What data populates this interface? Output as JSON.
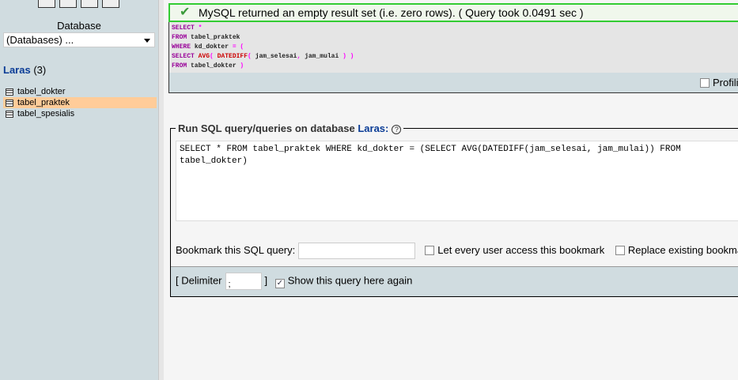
{
  "sidebar": {
    "toolbar_icons": [
      "home-icon",
      "sql-icon",
      "query-window-icon",
      "docs-icon"
    ],
    "database_label": "Database",
    "database_select": "(Databases) ...",
    "db_name": "Laras",
    "db_count": "(3)",
    "tables": [
      {
        "name": "tabel_dokter",
        "selected": false
      },
      {
        "name": "tabel_praktek",
        "selected": true
      },
      {
        "name": "tabel_spesialis",
        "selected": false
      }
    ]
  },
  "result": {
    "message": "MySQL returned an empty result set (i.e. zero rows). ( Query took 0.0491 sec )",
    "sql_lines": [
      [
        {
          "t": "SELECT",
          "c": "kw"
        },
        {
          "t": " *",
          "c": "pu"
        }
      ],
      [
        {
          "t": "FROM",
          "c": "kw"
        },
        {
          "t": " tabel_praktek",
          "c": ""
        }
      ],
      [
        {
          "t": "WHERE",
          "c": "kw"
        },
        {
          "t": " kd_dokter ",
          "c": ""
        },
        {
          "t": "= (",
          "c": "pu"
        }
      ],
      [
        {
          "t": "SELECT",
          "c": "kw"
        },
        {
          "t": " AVG",
          "c": "fn"
        },
        {
          "t": "( ",
          "c": "pu"
        },
        {
          "t": "DATEDIFF",
          "c": "fn"
        },
        {
          "t": "( ",
          "c": "pu"
        },
        {
          "t": "jam_selesai",
          "c": ""
        },
        {
          "t": ", ",
          "c": "pu"
        },
        {
          "t": "jam_mulai ",
          "c": ""
        },
        {
          "t": ") )",
          "c": "pu"
        }
      ],
      [
        {
          "t": "FROM",
          "c": "kw"
        },
        {
          "t": " tabel_dokter ",
          "c": ""
        },
        {
          "t": ")",
          "c": "pu"
        }
      ]
    ],
    "profiling_label": "Profili"
  },
  "query_form": {
    "legend": "Run SQL query/queries on database",
    "legend_db": "Laras:",
    "help_icon": "?",
    "query_text": "SELECT * FROM tabel_praktek WHERE kd_dokter = (SELECT AVG(DATEDIFF(jam_selesai, jam_mulai)) FROM tabel_dokter)",
    "bookmark_label": "Bookmark this SQL query:",
    "bookmark_value": "",
    "let_every_user": "Let every user access this bookmark",
    "replace_existing": "Replace existing bookmark",
    "delimiter_open": "[ Delimiter",
    "delimiter_value": ";",
    "delimiter_close": "]",
    "show_again_label": "Show this query here again",
    "show_again_checked": true
  }
}
